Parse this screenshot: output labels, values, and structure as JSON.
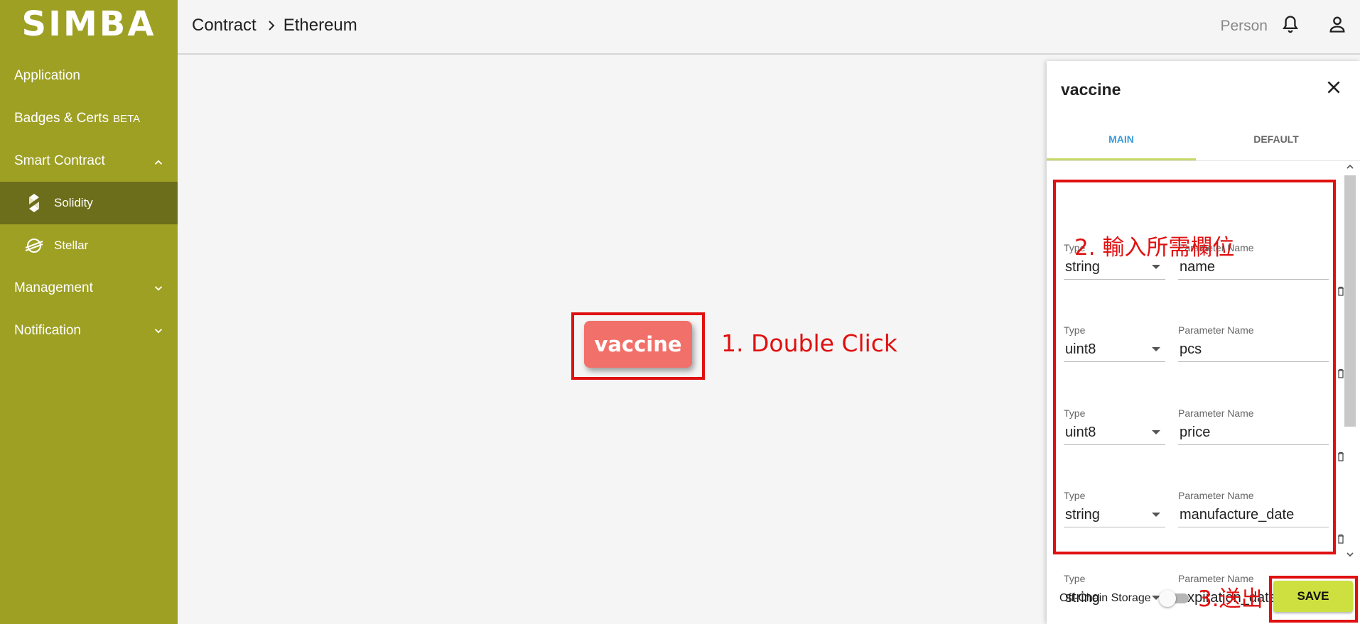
{
  "app": {
    "logo": "SIMBA"
  },
  "sidebar": {
    "items": [
      {
        "label": "Application"
      },
      {
        "label": "Badges & Certs",
        "badge": "BETA"
      },
      {
        "label": "Smart Contract",
        "expanded": true,
        "children": [
          {
            "label": "Solidity",
            "active": true
          },
          {
            "label": "Stellar"
          }
        ]
      },
      {
        "label": "Management"
      },
      {
        "label": "Notification"
      }
    ]
  },
  "header": {
    "breadcrumb": [
      "Contract",
      "Ethereum"
    ],
    "user_label": "Person"
  },
  "canvas": {
    "node_label": "vaccine"
  },
  "annotations": {
    "step1": "1. Double Click",
    "step2": "2. 輸入所需欄位",
    "step3": "3.送出"
  },
  "panel": {
    "title": "vaccine",
    "tabs": [
      {
        "label": "MAIN",
        "active": true
      },
      {
        "label": "DEFAULT"
      }
    ],
    "type_label": "Type",
    "name_label": "Parameter Name",
    "params": [
      {
        "type": "string",
        "name": "name"
      },
      {
        "type": "uint8",
        "name": "pcs"
      },
      {
        "type": "uint8",
        "name": "price"
      },
      {
        "type": "string",
        "name": "manufacture_date"
      },
      {
        "type": "string",
        "name": "expiration_date"
      }
    ],
    "offchain_label": "Off-Chain Storage",
    "offchain_enabled": false,
    "save_label": "SAVE"
  },
  "colors": {
    "sidebar": "#9ea024",
    "sidebar_active": "#6d6e1b",
    "node": "#f2706a",
    "save": "#cde040",
    "tab_active": "#3a9ad9",
    "annotation": "#e01010"
  }
}
